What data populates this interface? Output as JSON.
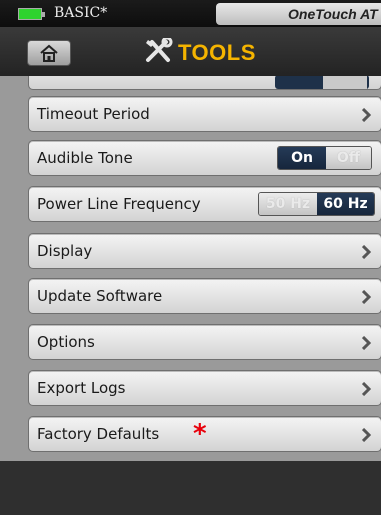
{
  "status": {
    "profile": "BASIC*",
    "device": "OneTouch AT"
  },
  "header": {
    "title": "TOOLS"
  },
  "rows": [
    {
      "label": "Timeout Period"
    },
    {
      "label": "Audible Tone",
      "toggle": {
        "on": "On",
        "off": "Off",
        "selected": "On"
      }
    },
    {
      "label": "Power Line Frequency",
      "toggle": {
        "a": "50 Hz",
        "b": "60 Hz",
        "selected": "60 Hz"
      }
    },
    {
      "label": "Display"
    },
    {
      "label": "Update Software"
    },
    {
      "label": "Options"
    },
    {
      "label": "Export Logs"
    },
    {
      "label": "Factory Defaults",
      "marker": "*"
    }
  ],
  "icons": {
    "battery": "battery-icon",
    "home": "home-icon",
    "tools": "tools-icon",
    "chevron": "chevron-right-icon"
  },
  "colors": {
    "title": "#f5b400",
    "toggle_active": "#1e3149",
    "marker": "#e8000b",
    "battery": "#2ed32e"
  }
}
